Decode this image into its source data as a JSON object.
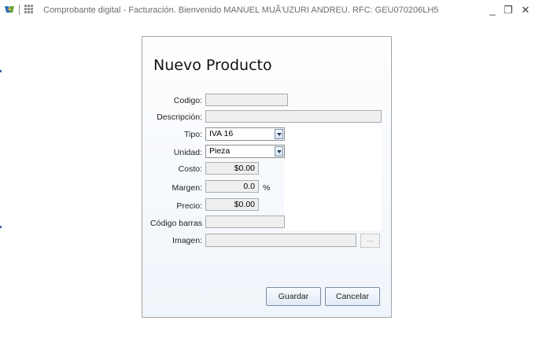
{
  "window": {
    "title": "Comprobante digital - Facturación. Bienvenido MANUEL MUÃ'UZURI ANDREU. RFC: GEU070206LH5",
    "minimize_label": "_",
    "maximize_label": "❐",
    "close_label": "✕"
  },
  "dialog": {
    "title": "Nuevo Producto",
    "fields": {
      "codigo": {
        "label": "Codigo:",
        "value": ""
      },
      "descripcion": {
        "label": "Descripción:",
        "value": ""
      },
      "tipo": {
        "label": "Tipo:",
        "value": "IVA 16"
      },
      "unidad": {
        "label": "Unidad:",
        "value": "Pieza"
      },
      "costo": {
        "label": "Costo:",
        "value": "$0.00"
      },
      "margen": {
        "label": "Margen:",
        "value": "0.0",
        "unit": "%"
      },
      "precio": {
        "label": "Precio:",
        "value": "$0.00"
      },
      "codigo_barras": {
        "label": "Código barras",
        "value": ""
      },
      "imagen": {
        "label": "Imagen:",
        "value": "",
        "browse_label": "..."
      }
    },
    "buttons": {
      "guardar": "Guardar",
      "cancelar": "Cancelar"
    }
  },
  "icons": {
    "app": "app-logo-icon",
    "grid": "grid-menu-icon",
    "dropdown": "chevron-down-icon"
  }
}
